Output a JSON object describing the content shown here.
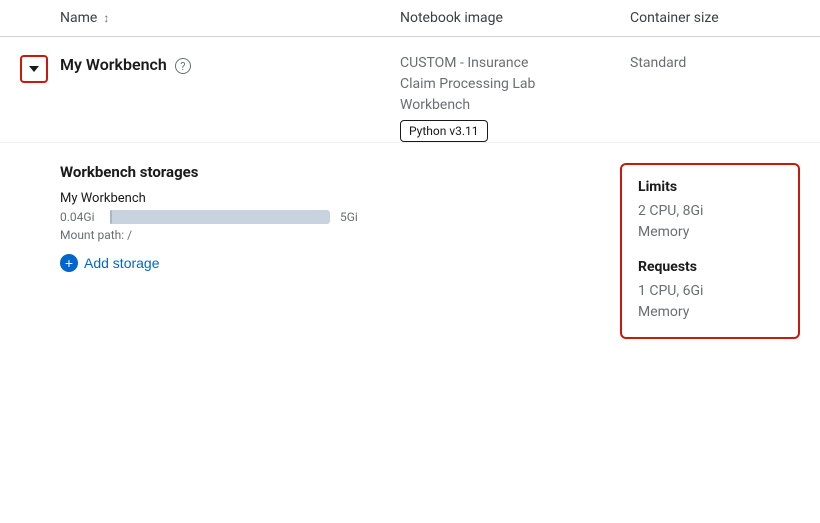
{
  "header": {
    "col_name": "Name",
    "col_notebook": "Notebook image",
    "col_container": "Container size"
  },
  "row": {
    "name": "My Workbench",
    "notebook_line1": "CUSTOM - Insurance",
    "notebook_line2": "Claim Processing Lab",
    "notebook_line3": "Workbench",
    "python_badge": "Python v3.11",
    "container_size": "Standard"
  },
  "storage": {
    "title": "Workbench storages",
    "storage_name": "My Workbench",
    "min_value": "0.04Gi",
    "max_value": "5Gi",
    "mount_label": "Mount path: /",
    "add_storage_label": "Add storage"
  },
  "limits": {
    "limits_heading": "Limits",
    "limits_value": "2 CPU, 8Gi\nMemory",
    "requests_heading": "Requests",
    "requests_value": "1 CPU, 6Gi\nMemory"
  },
  "icons": {
    "sort": "↕",
    "chevron_down": "▾",
    "help": "?",
    "plus": "+"
  }
}
